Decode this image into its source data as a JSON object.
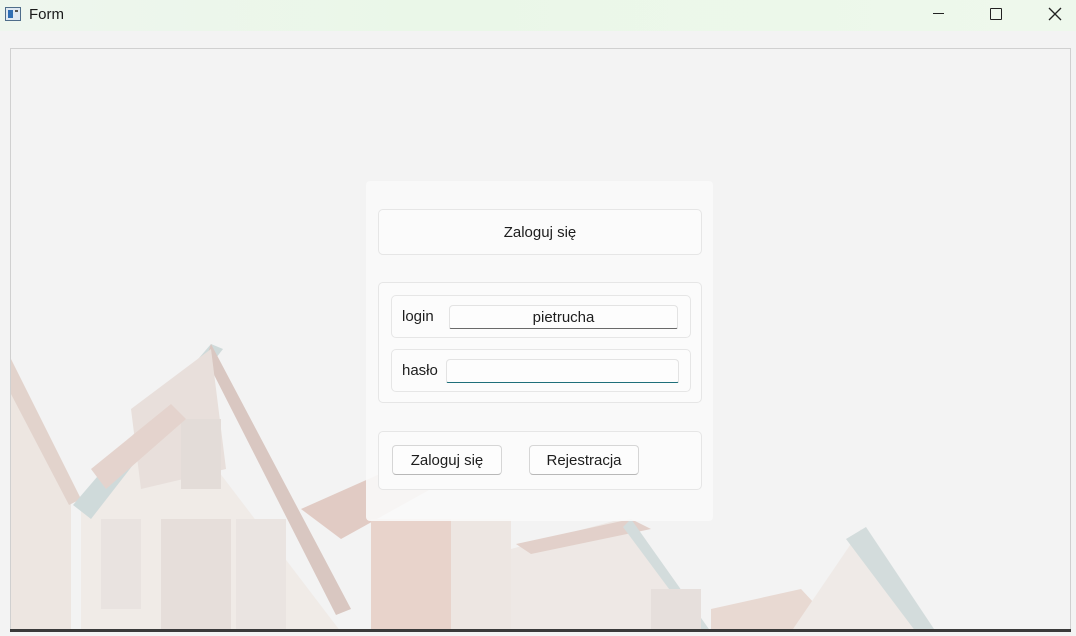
{
  "window": {
    "title": "Form",
    "icon": "app-window-icon",
    "controls": {
      "minimize": "minimize-icon",
      "maximize": "maximize-icon",
      "close": "close-icon"
    }
  },
  "login_form": {
    "heading": "Zaloguj się",
    "login_label": "login",
    "login_value": "pietrucha",
    "password_label": "hasło",
    "password_value": "",
    "login_button": "Zaloguj się",
    "register_button": "Rejestracja"
  },
  "colors": {
    "accent_focus": "#1f6f7a",
    "titlebar": "#eaf7e8"
  }
}
